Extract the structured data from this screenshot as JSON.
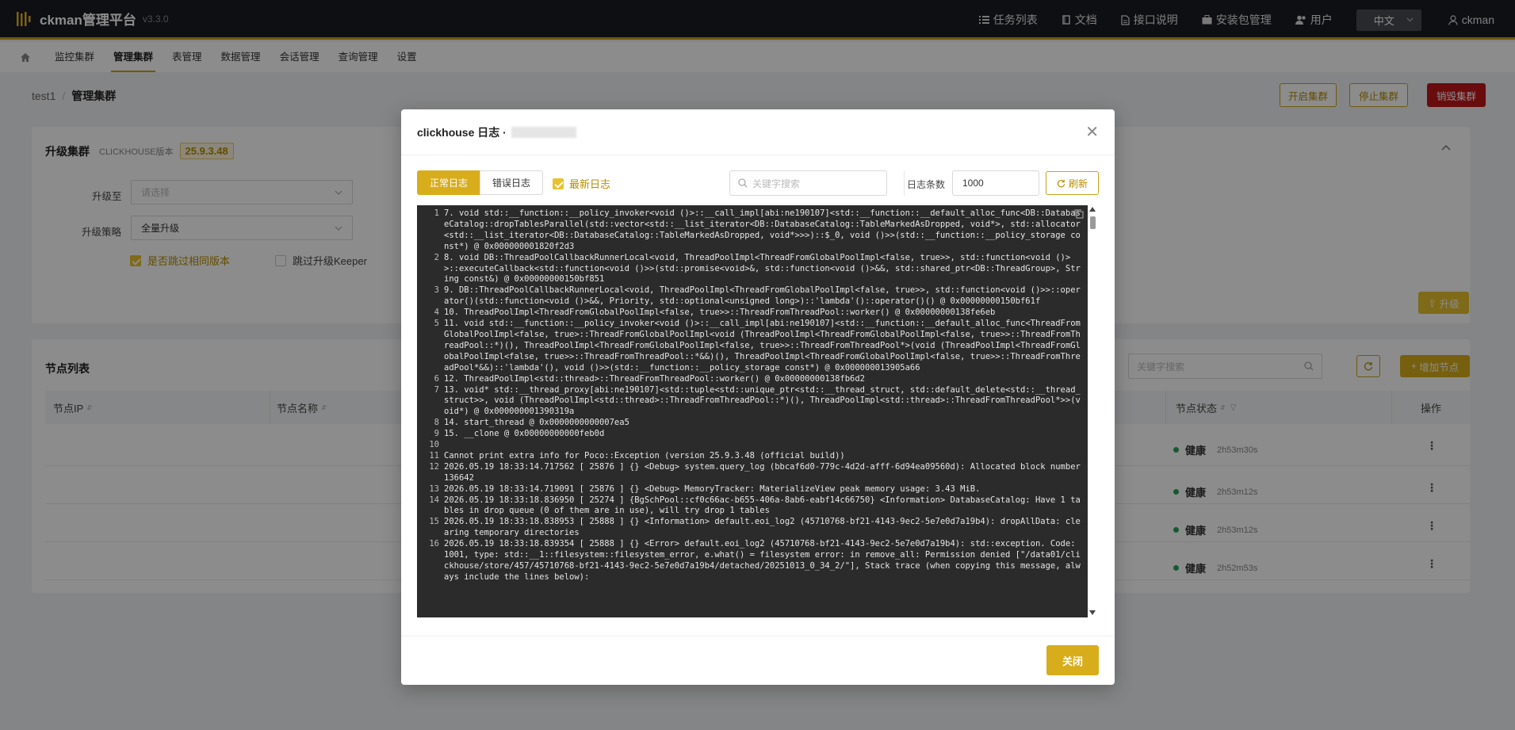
{
  "app": {
    "name": "ckman管理平台",
    "version": "v3.3.0"
  },
  "topnav": [
    {
      "icon": "list-icon",
      "label": "任务列表"
    },
    {
      "icon": "book-icon",
      "label": "文档"
    },
    {
      "icon": "doc-icon",
      "label": "接口说明"
    },
    {
      "icon": "package-icon",
      "label": "安装包管理"
    },
    {
      "icon": "users-icon",
      "label": "用户"
    }
  ],
  "lang": "中文",
  "username": "ckman",
  "menu": [
    "监控集群",
    "管理集群",
    "表管理",
    "数据管理",
    "会话管理",
    "查询管理",
    "设置"
  ],
  "breadcrumb": {
    "cluster": "test1",
    "page": "管理集群"
  },
  "header_buttons": {
    "start": "开启集群",
    "stop": "停止集群",
    "destroy": "销毁集群"
  },
  "upgrade": {
    "title": "升级集群",
    "ver_label": "CLICKHOUSE版本",
    "version": "25.9.3.48",
    "to_label": "升级至",
    "to_placeholder": "请选择",
    "strategy_label": "升级策略",
    "strategy_value": "全量升级",
    "skip_same": "是否跳过相同版本",
    "skip_keeper": "跳过升级Keeper",
    "upgrade_btn": "升级"
  },
  "nodes": {
    "title": "节点列表",
    "search_placeholder": "关键字搜索",
    "add_btn": "增加节点",
    "columns": [
      "节点IP",
      "节点名称",
      "节点状态",
      "操作"
    ],
    "rows": [
      {
        "status": "健康",
        "uptime": "2h53m30s"
      },
      {
        "status": "健康",
        "uptime": "2h53m12s"
      },
      {
        "status": "健康",
        "uptime": "2h53m12s"
      },
      {
        "status": "健康",
        "uptime": "2h52m53s"
      }
    ]
  },
  "modal": {
    "title": "clickhouse 日志 ·",
    "tab_normal": "正常日志",
    "tab_error": "错误日志",
    "latest": "最新日志",
    "search_placeholder": "关键字搜索",
    "count_label": "日志条数",
    "count_value": "1000",
    "refresh": "刷新",
    "close": "关闭",
    "lines": [
      {
        "n": "1",
        "t": "7. void std::__function::__policy_invoker<void ()>::__call_impl[abi:ne190107]<std::__function::__default_alloc_func<DB::DatabaseCatalog::dropTablesParallel(std::vector<std::__list_iterator<DB::DatabaseCatalog::TableMarkedAsDropped, void*>, std::allocator<std::__list_iterator<DB::DatabaseCatalog::TableMarkedAsDropped, void*>>>)::$_0, void ()>>(std::__function::__policy_storage const*) @ 0x000000001820f2d3"
      },
      {
        "n": "2",
        "t": "8. void DB::ThreadPoolCallbackRunnerLocal<void, ThreadPoolImpl<ThreadFromGlobalPoolImpl<false, true>>, std::function<void ()>>::executeCallback<std::function<void ()>>(std::promise<void>&, std::function<void ()>&&, std::shared_ptr<DB::ThreadGroup>, String const&) @ 0x00000000150bf851"
      },
      {
        "n": "3",
        "t": "9. DB::ThreadPoolCallbackRunnerLocal<void, ThreadPoolImpl<ThreadFromGlobalPoolImpl<false, true>>, std::function<void ()>>::operator()(std::function<void ()>&&, Priority, std::optional<unsigned long>)::'lambda'()::operator()() @ 0x00000000150bf61f"
      },
      {
        "n": "4",
        "t": "10. ThreadPoolImpl<ThreadFromGlobalPoolImpl<false, true>>::ThreadFromThreadPool::worker() @ 0x00000000138fe6eb"
      },
      {
        "n": "5",
        "t": "11. void std::__function::__policy_invoker<void ()>::__call_impl[abi:ne190107]<std::__function::__default_alloc_func<ThreadFromGlobalPoolImpl<false, true>::ThreadFromGlobalPoolImpl<void (ThreadPoolImpl<ThreadFromGlobalPoolImpl<false, true>>::ThreadFromThreadPool::*)(), ThreadPoolImpl<ThreadFromGlobalPoolImpl<false, true>>::ThreadFromThreadPool*>(void (ThreadPoolImpl<ThreadFromGlobalPoolImpl<false, true>>::ThreadFromThreadPool::*&&)(), ThreadPoolImpl<ThreadFromGlobalPoolImpl<false, true>>::ThreadFromThreadPool*&&)::'lambda'(), void ()>>(std::__function::__policy_storage const*) @ 0x000000013905a66"
      },
      {
        "n": "6",
        "t": "12. ThreadPoolImpl<std::thread>::ThreadFromThreadPool::worker() @ 0x00000000138fb6d2"
      },
      {
        "n": "7",
        "t": "13. void* std::__thread_proxy[abi:ne190107]<std::tuple<std::unique_ptr<std::__thread_struct, std::default_delete<std::__thread_struct>>, void (ThreadPoolImpl<std::thread>::ThreadFromThreadPool::*)(), ThreadPoolImpl<std::thread>::ThreadFromThreadPool*>>(void*) @ 0x000000001390319a"
      },
      {
        "n": "8",
        "t": "14. start_thread @ 0x0000000000007ea5"
      },
      {
        "n": "9",
        "t": "15. __clone @ 0x00000000000feb0d"
      },
      {
        "n": "10",
        "t": ""
      },
      {
        "n": "11",
        "t": "Cannot print extra info for Poco::Exception (version 25.9.3.48 (official build))"
      },
      {
        "n": "12",
        "t": "2026.05.19 18:33:14.717562 [ 25876 ] {} <Debug> system.query_log (bbcaf6d0-779c-4d2d-afff-6d94ea09560d): Allocated block number 136642"
      },
      {
        "n": "13",
        "t": "2026.05.19 18:33:14.719091 [ 25876 ] {} <Debug> MemoryTracker: MaterializeView peak memory usage: 3.43 MiB."
      },
      {
        "n": "14",
        "t": "2026.05.19 18:33:18.836950 [ 25274 ] {BgSchPool::cf0c66ac-b655-406a-8ab6-eabf14c66750} <Information> DatabaseCatalog: Have 1 tables in drop queue (0 of them are in use), will try drop 1 tables"
      },
      {
        "n": "15",
        "t": "2026.05.19 18:33:18.838953 [ 25888 ] {} <Information> default.eoi_log2 (45710768-bf21-4143-9ec2-5e7e0d7a19b4): dropAllData: clearing temporary directories"
      },
      {
        "n": "16",
        "t": "2026.05.19 18:33:18.839354 [ 25888 ] {} <Error> default.eoi_log2 (45710768-bf21-4143-9ec2-5e7e0d7a19b4): std::exception. Code: 1001, type: std::__1::filesystem::filesystem_error, e.what() = filesystem error: in remove_all: Permission denied [\"/data01/clickhouse/store/457/45710768-bf21-4143-9ec2-5e7e0d7a19b4/detached/20251013_0_34_2/\"], Stack trace (when copying this message, always include the lines below):"
      }
    ]
  }
}
